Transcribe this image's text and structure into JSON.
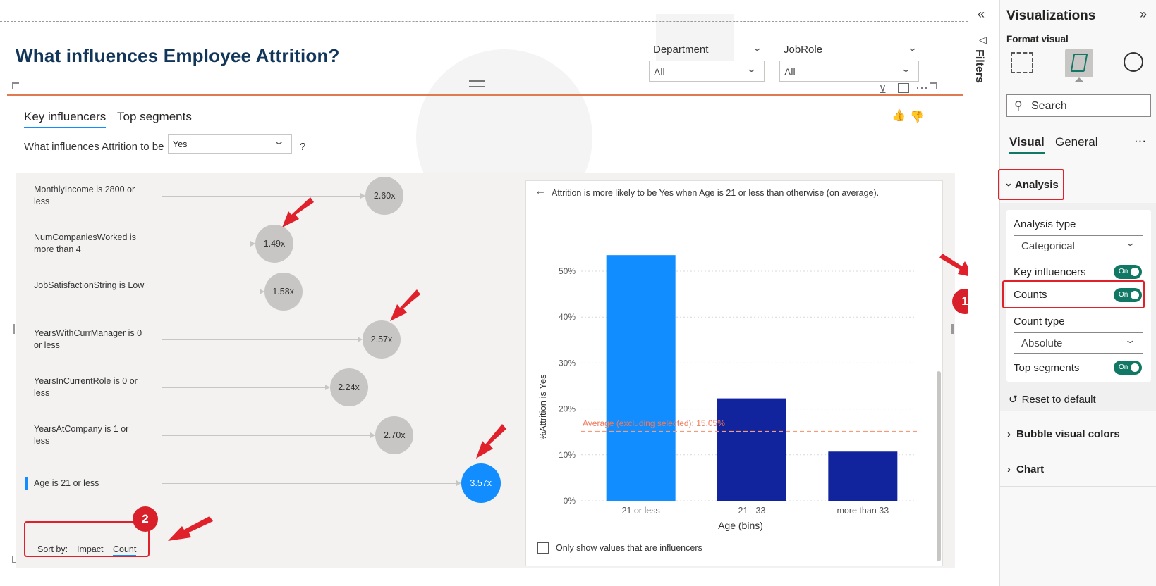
{
  "report": {
    "title": "What influences Employee Attrition?",
    "slicers": [
      {
        "label": "Department",
        "value": "All"
      },
      {
        "label": "JobRole",
        "value": "All"
      }
    ]
  },
  "visual": {
    "tabs": [
      "Key influencers",
      "Top segments"
    ],
    "question_prefix": "What influences Attrition to be",
    "question_value": "Yes",
    "question_suffix": "?",
    "factors": [
      {
        "label": "MonthlyIncome is 2800 or less",
        "value": "2.60x",
        "impact": 2.6
      },
      {
        "label": "NumCompaniesWorked is more than 4",
        "value": "1.49x",
        "impact": 1.49
      },
      {
        "label": "JobSatisfactionString is Low",
        "value": "1.58x",
        "impact": 1.58
      },
      {
        "label": "YearsWithCurrManager is 0 or less",
        "value": "2.57x",
        "impact": 2.57
      },
      {
        "label": "YearsInCurrentRole is 0 or less",
        "value": "2.24x",
        "impact": 2.24
      },
      {
        "label": "YearsAtCompany is 1 or less",
        "value": "2.70x",
        "impact": 2.7
      },
      {
        "label": "Age is 21 or less",
        "value": "3.57x",
        "impact": 3.57,
        "selected": true
      }
    ],
    "sort": {
      "label": "Sort by:",
      "options": [
        "Impact",
        "Count"
      ],
      "active": "Count"
    },
    "annotations": {
      "badge1": "1",
      "badge2": "2"
    },
    "detail": {
      "headline": "Attrition is more likely to be Yes when Age is 21 or less than otherwise (on average).",
      "checkbox_label": "Only show values that are influencers"
    }
  },
  "chart_data": {
    "type": "bar",
    "categories": [
      "21 or less",
      "21 - 33",
      "more than 33"
    ],
    "values": [
      53.5,
      22.3,
      10.7
    ],
    "xlabel": "Age (bins)",
    "ylabel": "%Attrition is Yes",
    "ylim": [
      0,
      50
    ],
    "yticks": [
      0,
      10,
      20,
      30,
      40,
      50
    ],
    "ytick_labels": [
      "0%",
      "10%",
      "20%",
      "30%",
      "40%",
      "50%"
    ],
    "reference_line": {
      "label": "Average (excluding selected): 15.05%",
      "value": 15.05
    },
    "grid": true,
    "colors": [
      "#118dff",
      "#12239e",
      "#12239e"
    ]
  },
  "pane": {
    "filters_label": "Filters",
    "title": "Visualizations",
    "subtitle": "Format visual",
    "search_placeholder": "Search",
    "tabs": [
      "Visual",
      "General"
    ],
    "more": "···",
    "analysis": {
      "label": "Analysis",
      "analysis_type_label": "Analysis type",
      "analysis_type_value": "Categorical",
      "key_influencers_label": "Key influencers",
      "counts_label": "Counts",
      "count_type_label": "Count type",
      "count_type_value": "Absolute",
      "top_segments_label": "Top segments",
      "toggle_text": "On",
      "reset_label": "Reset to default"
    },
    "sections": [
      "Bubble visual colors",
      "Chart"
    ]
  },
  "colors": {
    "accent": "#118dff",
    "dark_bar": "#12239e",
    "toggle": "#117865",
    "annotation": "#e0202a",
    "title": "#12365a"
  }
}
